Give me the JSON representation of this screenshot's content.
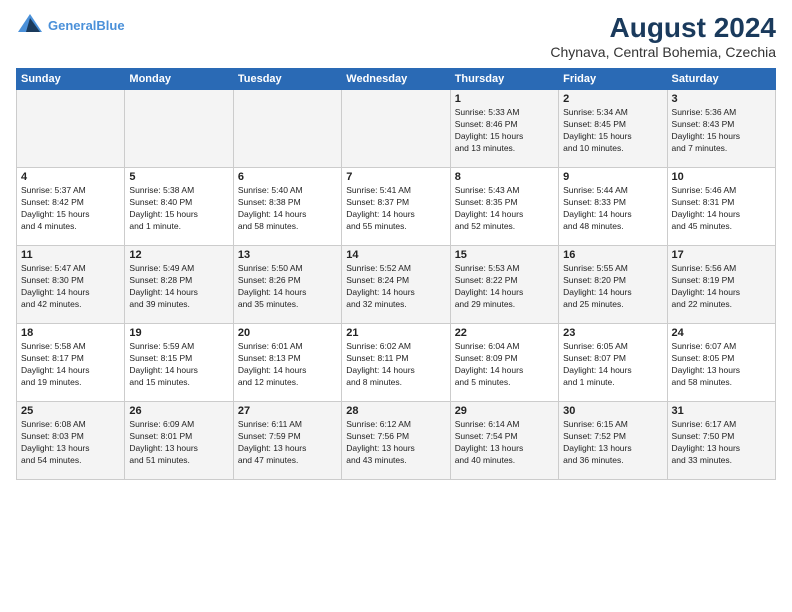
{
  "header": {
    "logo_line1": "General",
    "logo_line2": "Blue",
    "month_year": "August 2024",
    "location": "Chynava, Central Bohemia, Czechia"
  },
  "weekdays": [
    "Sunday",
    "Monday",
    "Tuesday",
    "Wednesday",
    "Thursday",
    "Friday",
    "Saturday"
  ],
  "weeks": [
    [
      {
        "day": "",
        "info": ""
      },
      {
        "day": "",
        "info": ""
      },
      {
        "day": "",
        "info": ""
      },
      {
        "day": "",
        "info": ""
      },
      {
        "day": "1",
        "info": "Sunrise: 5:33 AM\nSunset: 8:46 PM\nDaylight: 15 hours\nand 13 minutes."
      },
      {
        "day": "2",
        "info": "Sunrise: 5:34 AM\nSunset: 8:45 PM\nDaylight: 15 hours\nand 10 minutes."
      },
      {
        "day": "3",
        "info": "Sunrise: 5:36 AM\nSunset: 8:43 PM\nDaylight: 15 hours\nand 7 minutes."
      }
    ],
    [
      {
        "day": "4",
        "info": "Sunrise: 5:37 AM\nSunset: 8:42 PM\nDaylight: 15 hours\nand 4 minutes."
      },
      {
        "day": "5",
        "info": "Sunrise: 5:38 AM\nSunset: 8:40 PM\nDaylight: 15 hours\nand 1 minute."
      },
      {
        "day": "6",
        "info": "Sunrise: 5:40 AM\nSunset: 8:38 PM\nDaylight: 14 hours\nand 58 minutes."
      },
      {
        "day": "7",
        "info": "Sunrise: 5:41 AM\nSunset: 8:37 PM\nDaylight: 14 hours\nand 55 minutes."
      },
      {
        "day": "8",
        "info": "Sunrise: 5:43 AM\nSunset: 8:35 PM\nDaylight: 14 hours\nand 52 minutes."
      },
      {
        "day": "9",
        "info": "Sunrise: 5:44 AM\nSunset: 8:33 PM\nDaylight: 14 hours\nand 48 minutes."
      },
      {
        "day": "10",
        "info": "Sunrise: 5:46 AM\nSunset: 8:31 PM\nDaylight: 14 hours\nand 45 minutes."
      }
    ],
    [
      {
        "day": "11",
        "info": "Sunrise: 5:47 AM\nSunset: 8:30 PM\nDaylight: 14 hours\nand 42 minutes."
      },
      {
        "day": "12",
        "info": "Sunrise: 5:49 AM\nSunset: 8:28 PM\nDaylight: 14 hours\nand 39 minutes."
      },
      {
        "day": "13",
        "info": "Sunrise: 5:50 AM\nSunset: 8:26 PM\nDaylight: 14 hours\nand 35 minutes."
      },
      {
        "day": "14",
        "info": "Sunrise: 5:52 AM\nSunset: 8:24 PM\nDaylight: 14 hours\nand 32 minutes."
      },
      {
        "day": "15",
        "info": "Sunrise: 5:53 AM\nSunset: 8:22 PM\nDaylight: 14 hours\nand 29 minutes."
      },
      {
        "day": "16",
        "info": "Sunrise: 5:55 AM\nSunset: 8:20 PM\nDaylight: 14 hours\nand 25 minutes."
      },
      {
        "day": "17",
        "info": "Sunrise: 5:56 AM\nSunset: 8:19 PM\nDaylight: 14 hours\nand 22 minutes."
      }
    ],
    [
      {
        "day": "18",
        "info": "Sunrise: 5:58 AM\nSunset: 8:17 PM\nDaylight: 14 hours\nand 19 minutes."
      },
      {
        "day": "19",
        "info": "Sunrise: 5:59 AM\nSunset: 8:15 PM\nDaylight: 14 hours\nand 15 minutes."
      },
      {
        "day": "20",
        "info": "Sunrise: 6:01 AM\nSunset: 8:13 PM\nDaylight: 14 hours\nand 12 minutes."
      },
      {
        "day": "21",
        "info": "Sunrise: 6:02 AM\nSunset: 8:11 PM\nDaylight: 14 hours\nand 8 minutes."
      },
      {
        "day": "22",
        "info": "Sunrise: 6:04 AM\nSunset: 8:09 PM\nDaylight: 14 hours\nand 5 minutes."
      },
      {
        "day": "23",
        "info": "Sunrise: 6:05 AM\nSunset: 8:07 PM\nDaylight: 14 hours\nand 1 minute."
      },
      {
        "day": "24",
        "info": "Sunrise: 6:07 AM\nSunset: 8:05 PM\nDaylight: 13 hours\nand 58 minutes."
      }
    ],
    [
      {
        "day": "25",
        "info": "Sunrise: 6:08 AM\nSunset: 8:03 PM\nDaylight: 13 hours\nand 54 minutes."
      },
      {
        "day": "26",
        "info": "Sunrise: 6:09 AM\nSunset: 8:01 PM\nDaylight: 13 hours\nand 51 minutes."
      },
      {
        "day": "27",
        "info": "Sunrise: 6:11 AM\nSunset: 7:59 PM\nDaylight: 13 hours\nand 47 minutes."
      },
      {
        "day": "28",
        "info": "Sunrise: 6:12 AM\nSunset: 7:56 PM\nDaylight: 13 hours\nand 43 minutes."
      },
      {
        "day": "29",
        "info": "Sunrise: 6:14 AM\nSunset: 7:54 PM\nDaylight: 13 hours\nand 40 minutes."
      },
      {
        "day": "30",
        "info": "Sunrise: 6:15 AM\nSunset: 7:52 PM\nDaylight: 13 hours\nand 36 minutes."
      },
      {
        "day": "31",
        "info": "Sunrise: 6:17 AM\nSunset: 7:50 PM\nDaylight: 13 hours\nand 33 minutes."
      }
    ]
  ]
}
